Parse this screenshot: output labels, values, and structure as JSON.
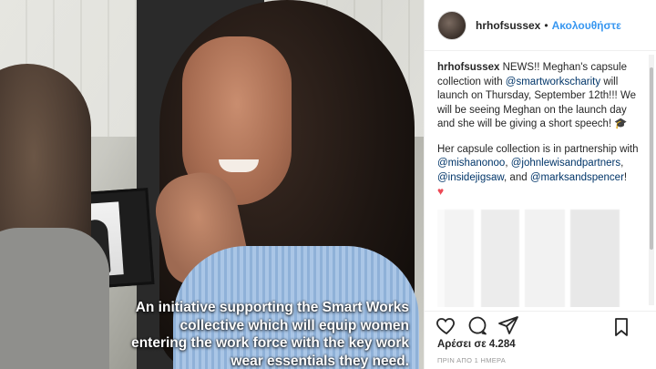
{
  "header": {
    "username": "hrhofsussex",
    "separator": "•",
    "follow_label": "Ακολουθήστε"
  },
  "media": {
    "caption_lines": [
      "An initiative supporting the Smart Works",
      "collective which will equip women",
      "entering the work force with the key work",
      "wear essentials they need."
    ]
  },
  "comment": {
    "username": "hrhofsussex",
    "text_1": " NEWS!! Meghan's capsule collection with ",
    "mention_1": "@smartworkscharity",
    "text_2": " will launch on Thursday, September 12th!!! We will be seeing Meghan on the launch day and she will be giving a short speech! ",
    "emoji_1": "🎓",
    "text_3": "Her capsule collection is in partnership with ",
    "mention_2": "@mishanonoo",
    "text_4": ", ",
    "mention_3": "@johnlewisandpartners",
    "text_5": ", ",
    "mention_4": "@insidejigsaw",
    "text_6": ", and ",
    "mention_5": "@marksandspencer",
    "text_7": "!",
    "emoji_2": "♥"
  },
  "actions": {
    "like_icon": "heart-icon",
    "comment_icon": "comment-icon",
    "share_icon": "share-icon",
    "save_icon": "bookmark-icon"
  },
  "likes_text": "Αρέσει σε 4.284",
  "timestamp": "ΠΡΙΝ ΑΠΟ 1 ΗΜΕΡΑ",
  "colors": {
    "link_blue": "#3897f0",
    "mention": "#003569",
    "text": "#262626",
    "heart": "#ed4956"
  }
}
